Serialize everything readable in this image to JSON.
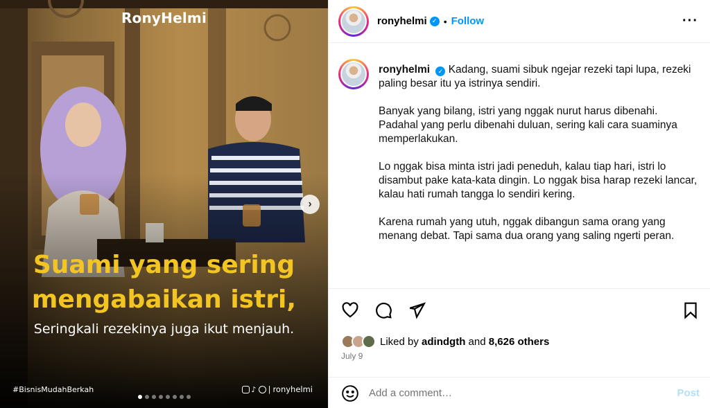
{
  "media": {
    "brand": "RonyHelmi",
    "headline_line1": "Suami yang sering",
    "headline_line2": "mengabaikan istri,",
    "subline": "Seringkali rezekinya juga ikut menjauh.",
    "hashtag": "#BisnisMudahBerkah",
    "social_handle": "ronyhelmi",
    "slide_count": 8,
    "active_slide": 0,
    "next_icon": "chevron-right-icon",
    "accent_color": "#f3c523"
  },
  "header": {
    "username": "ronyhelmi",
    "separator": "•",
    "follow_label": "Follow",
    "more_icon": "more-horizontal-icon",
    "verified_icon": "verified-badge-icon"
  },
  "caption": {
    "username": "ronyhelmi",
    "paragraphs": [
      "Kadang, suami sibuk ngejar rezeki tapi lupa, rezeki paling besar itu ya istrinya sendiri.",
      "Banyak yang bilang, istri yang nggak nurut harus dibenahi. Padahal yang perlu dibenahi duluan, sering kali cara suaminya memperlakukan.",
      "Lo nggak bisa minta istri jadi peneduh, kalau tiap hari, istri lo disambut pake kata-kata dingin. Lo nggak bisa harap rezeki lancar, kalau hati rumah tangga lo sendiri kering.",
      "Karena rumah yang utuh, nggak dibangun sama orang yang menang debat. Tapi sama dua orang yang saling ngerti peran."
    ]
  },
  "actions": {
    "like_icon": "heart-icon",
    "comment_icon": "comment-icon",
    "share_icon": "send-icon",
    "save_icon": "bookmark-icon",
    "liked_by_prefix": "Liked by",
    "liked_by_user": "adindgth",
    "and_text": "and",
    "others_text": "8,626 others",
    "date": "July 9"
  },
  "comment": {
    "emoji_icon": "emoji-icon",
    "placeholder": "Add a comment…",
    "post_label": "Post"
  },
  "colors": {
    "link_blue": "#0095f6",
    "post_disabled": "#b2dffc",
    "muted": "#737373"
  }
}
